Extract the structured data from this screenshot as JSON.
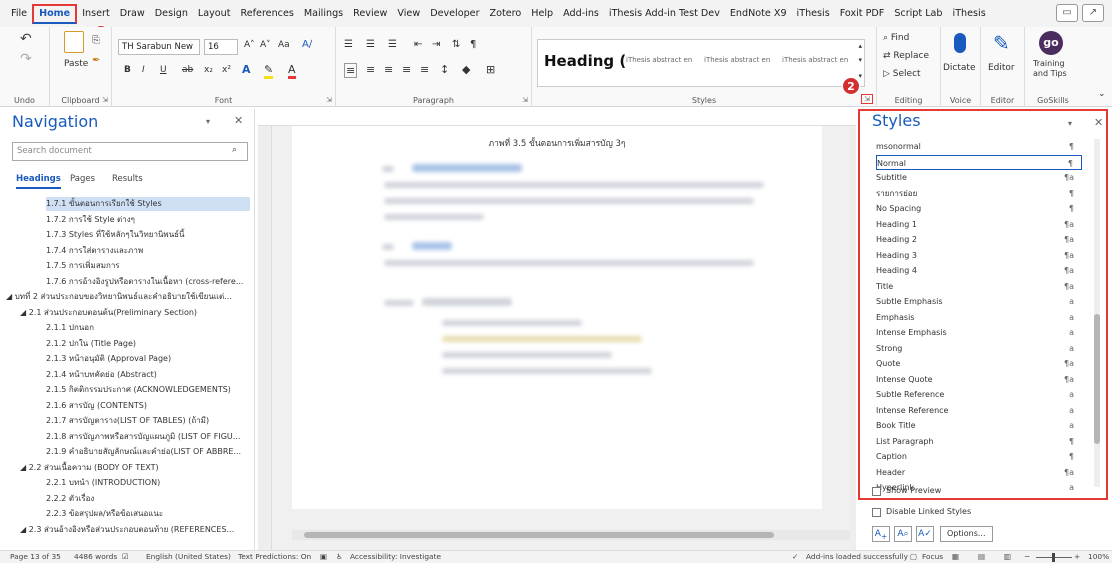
{
  "menubar": {
    "tabs": [
      "File",
      "Home",
      "Insert",
      "Draw",
      "Design",
      "Layout",
      "References",
      "Mailings",
      "Review",
      "View",
      "Developer",
      "Zotero",
      "Help",
      "Add-ins",
      "iThesis Add-in Test Dev",
      "EndNote X9",
      "iThesis",
      "Foxit PDF",
      "Script Lab",
      "iThesis"
    ],
    "active": "Home"
  },
  "badges": {
    "one": "1",
    "two": "2"
  },
  "ribbon": {
    "undo_label": "Undo",
    "clipboard": {
      "label": "Clipboard",
      "paste": "Paste"
    },
    "font": {
      "label": "Font",
      "name": "TH Sarabun New",
      "size": "16",
      "aa": "Aa",
      "bold": "B",
      "italic": "I",
      "underline": "U",
      "strike": "ab",
      "sub": "x₂",
      "sup": "x²",
      "grow": "A˄",
      "shrink": "A˅"
    },
    "paragraph": {
      "label": "Paragraph"
    },
    "styles": {
      "label": "Styles",
      "heading_preview": "Heading (",
      "item1": "iThesis abstract en",
      "item2": "iThesis abstract en",
      "item3": "iThesis abstract en"
    },
    "editing": {
      "label": "Editing",
      "find": "Find",
      "replace": "Replace",
      "select": "Select"
    },
    "voice": {
      "label": "Voice",
      "dictate": "Dictate"
    },
    "editor": {
      "label": "Editor",
      "editor": "Editor"
    },
    "goskills": {
      "label": "GoSkills",
      "training": "Training",
      "and_tips": "and Tips",
      "logo": "go"
    }
  },
  "nav": {
    "title": "Navigation",
    "search_placeholder": "Search document",
    "tabs": [
      "Headings",
      "Pages",
      "Results"
    ],
    "items": [
      "1.7.1 ขั้นตอนการเรียกใช้ Styles",
      "1.7.2 การใช้ Style ต่างๆ",
      "1.7.3 Styles ที่ใช้หลักๆในวิทยานิพนธ์นี้",
      "1.7.4 การใส่ตารางและภาพ",
      "1.7.5 การเพิ่มสมการ",
      "1.7.6 การอ้างอิงรูปหรือตารางในเนื้อหา (cross-refere...",
      "บทที่ 2  ส่วนประกอบของวิทยานิพนธ์และคำอธิบายใช้เขียนแต่...",
      "2.1 ส่วนประกอบตอนต้น(Preliminary Section)",
      "2.1.1 ปกนอก",
      "2.1.2 ปกใน (Title Page)",
      "2.1.3 หน้าอนุมัติ (Approval Page)",
      "2.1.4 หน้าบทคัดย่อ (Abstract)",
      "2.1.5 กิตติกรรมประกาศ (ACKNOWLEDGEMENTS)",
      "2.1.6 สารบัญ (CONTENTS)",
      "2.1.7 สารบัญตาราง(LIST OF TABLES) (ถ้ามี)",
      "2.1.8 สารบัญภาพหรือสารบัญแผนภูมิ (LIST OF FIGU...",
      "2.1.9 คำอธิบายสัญลักษณ์และคำย่อ(LIST OF ABBRE...",
      "2.2 ส่วนเนื้อความ (BODY OF TEXT)",
      "2.2.1 บทนำ (INTRODUCTION)",
      "2.2.2 ตัวเรื่อง",
      "2.2.3 ข้อสรุปผล/หรือข้อเสนอแนะ",
      "2.3 ส่วนอ้างอิงหรือส่วนประกอบตอนท้าย (REFERENCES..."
    ]
  },
  "doc": {
    "caption": "ภาพที่ 3.5 ขั้นตอนการเพิ่มสารบัญ 3ๆ"
  },
  "styles_pane": {
    "title": "Styles",
    "items": [
      {
        "name": "msonormal",
        "mark": "¶"
      },
      {
        "name": "Normal",
        "mark": "¶"
      },
      {
        "name": "Subtitle",
        "mark": "¶a"
      },
      {
        "name": "รายการย่อย",
        "mark": "¶"
      },
      {
        "name": "No Spacing",
        "mark": "¶"
      },
      {
        "name": "Heading 1",
        "mark": "¶a"
      },
      {
        "name": "Heading 2",
        "mark": "¶a"
      },
      {
        "name": "Heading 3",
        "mark": "¶a"
      },
      {
        "name": "Heading 4",
        "mark": "¶a"
      },
      {
        "name": "Title",
        "mark": "¶a"
      },
      {
        "name": "Subtle Emphasis",
        "mark": "a"
      },
      {
        "name": "Emphasis",
        "mark": "a"
      },
      {
        "name": "Intense Emphasis",
        "mark": "a"
      },
      {
        "name": "Strong",
        "mark": "a"
      },
      {
        "name": "Quote",
        "mark": "¶a"
      },
      {
        "name": "Intense Quote",
        "mark": "¶a"
      },
      {
        "name": "Subtle Reference",
        "mark": "a"
      },
      {
        "name": "Intense Reference",
        "mark": "a"
      },
      {
        "name": "Book Title",
        "mark": "a"
      },
      {
        "name": "List Paragraph",
        "mark": "¶"
      },
      {
        "name": "Caption",
        "mark": "¶"
      },
      {
        "name": "Header",
        "mark": "¶a"
      },
      {
        "name": "Hyperlink",
        "mark": "a"
      }
    ],
    "selected": "Normal",
    "show_preview": "Show Preview",
    "disable_linked": "Disable Linked Styles",
    "options": "Options..."
  },
  "status": {
    "page": "Page 13 of 35",
    "words": "4486 words",
    "language": "English (United States)",
    "predictions": "Text Predictions: On",
    "accessibility": "Accessibility: Investigate",
    "addins": "Add-ins loaded successfully",
    "focus": "Focus",
    "zoom": "100%"
  }
}
